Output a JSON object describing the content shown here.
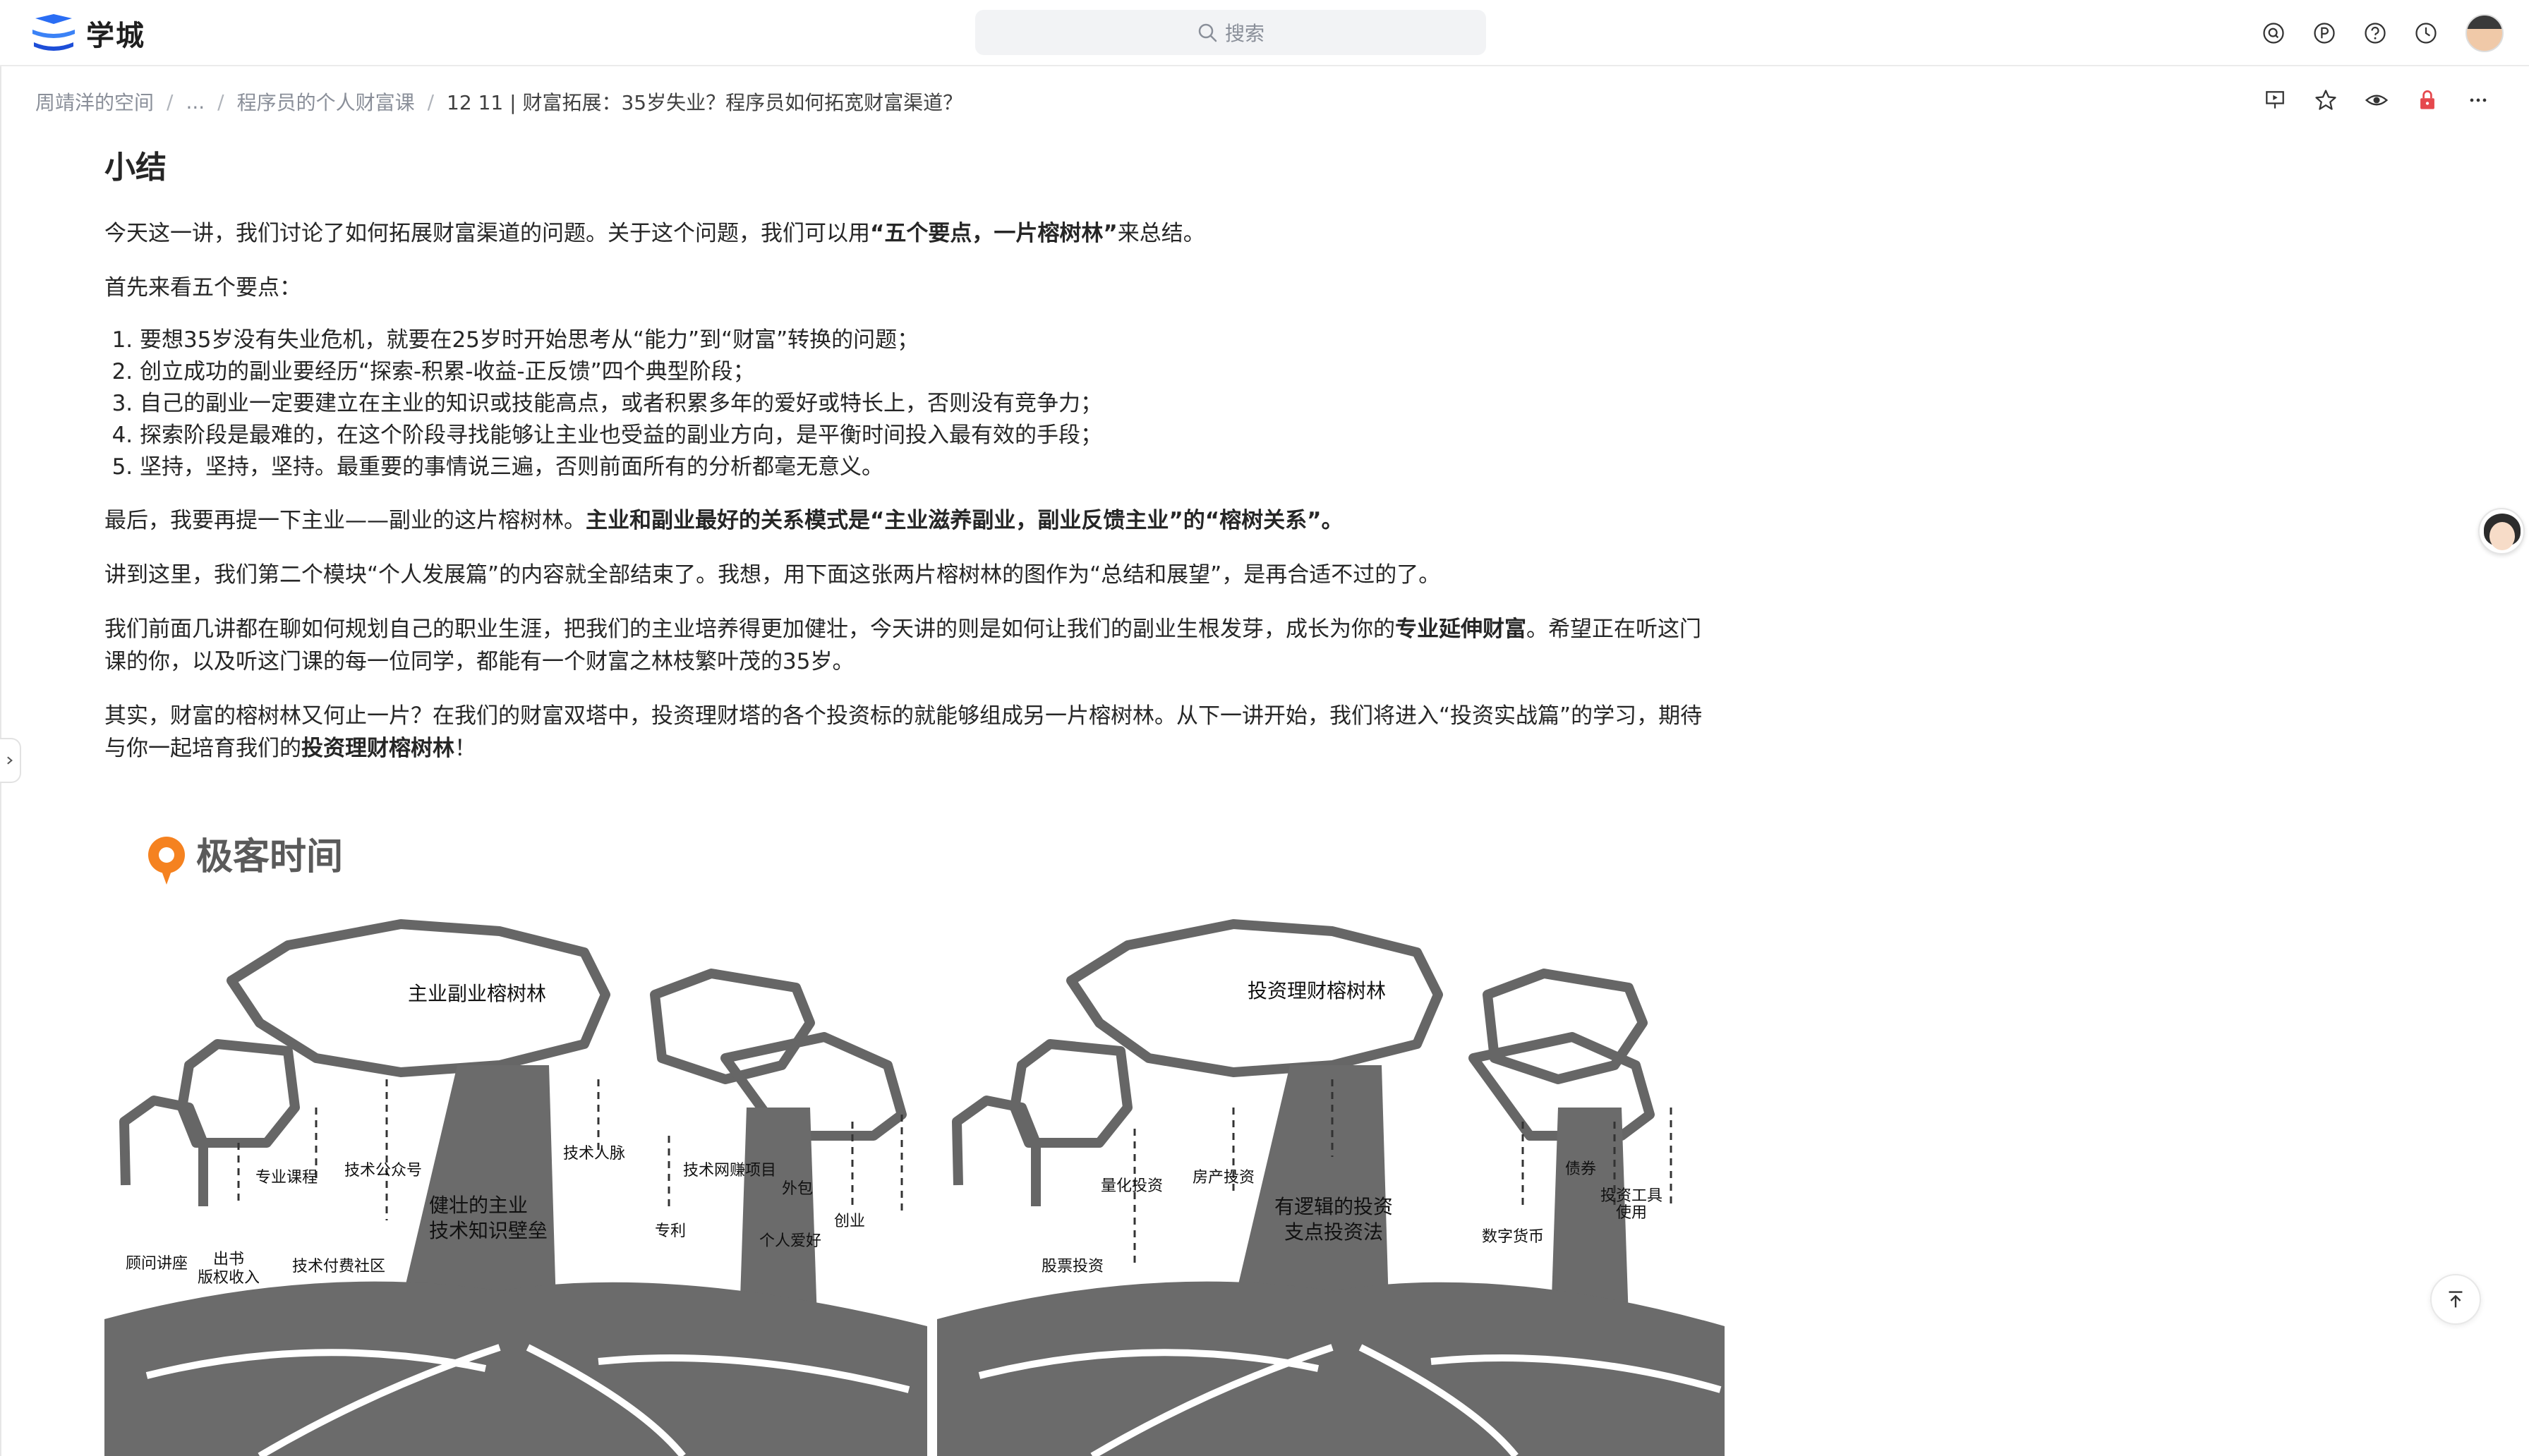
{
  "app": {
    "name": "学城"
  },
  "search": {
    "placeholder": "搜索"
  },
  "top_icons": [
    "q-circle-icon",
    "p-circle-icon",
    "help-icon",
    "history-icon",
    "avatar"
  ],
  "breadcrumb": {
    "items": [
      "周靖洋的空间",
      "...",
      "程序员的个人财富课",
      "12 11 | 财富拓展：35岁失业？程序员如何拓宽财富渠道？"
    ]
  },
  "doc_actions": [
    "present-icon",
    "star-icon",
    "eye-icon",
    "lock-icon",
    "more-icon"
  ],
  "article": {
    "heading": "小结",
    "p1": {
      "a": "今天这一讲，我们讨论了如何拓展财富渠道的问题。关于这个问题，我们可以用",
      "b": "“五个要点，一片榕树林”",
      "c": "来总结。"
    },
    "p2": "首先来看五个要点：",
    "list": [
      "要想35岁没有失业危机，就要在25岁时开始思考从“能力”到“财富”转换的问题；",
      "创立成功的副业要经历“探索-积累-收益-正反馈”四个典型阶段；",
      "自己的副业一定要建立在主业的知识或技能高点，或者积累多年的爱好或特长上，否则没有竞争力；",
      "探索阶段是最难的，在这个阶段寻找能够让主业也受益的副业方向，是平衡时间投入最有效的手段；",
      "坚持，坚持，坚持。最重要的事情说三遍，否则前面所有的分析都毫无意义。"
    ],
    "p3": {
      "a": "最后，我要再提一下主业——副业的这片榕树林。",
      "b": "主业和副业最好的关系模式是“主业滋养副业，副业反馈主业”的“榕树关系”。"
    },
    "p4": "讲到这里，我们第二个模块“个人发展篇”的内容就全部结束了。我想，用下面这张两片榕树林的图作为“总结和展望”，是再合适不过的了。",
    "p5": {
      "a": "我们前面几讲都在聊如何规划自己的职业生涯，把我们的主业培养得更加健壮，今天讲的则是如何让我们的副业生根发芽，成长为你的",
      "b": "专业延伸财富",
      "c": "。希望正在听这门课的你，以及听这门课的每一位同学，都能有一个财富之林枝繁叶茂的35岁。"
    },
    "p6": {
      "a": "其实，财富的榕树林又何止一片？在我们的财富双塔中，投资理财塔的各个投资标的就能够组成另一片榕树林。从下一讲开始，我们将进入“投资实战篇”的学习，期待与你一起培育我们的",
      "b": "投资理财榕树林",
      "c": "！"
    }
  },
  "figure": {
    "brand": "极客时间",
    "left_tree": {
      "title": "主业副业榕树林",
      "trunk": [
        "健壮的主业",
        "技术知识壁垒"
      ],
      "labels": [
        "专业课程",
        "技术公众号",
        "技术人脉",
        "技术网赚项目",
        "外包",
        "创业",
        "专利",
        "个人爱好",
        "顾问讲座",
        "出书",
        "版权收入",
        "技术付费社区"
      ]
    },
    "right_tree": {
      "title": "投资理财榕树林",
      "trunk": [
        "有逻辑的投资",
        "支点投资法"
      ],
      "labels": [
        "量化投资",
        "房产投资",
        "债券",
        "投资工具",
        "使用",
        "数字货币",
        "股票投资"
      ]
    }
  },
  "colors": {
    "accent": "#1f6fff",
    "tree": "#6b6b6b",
    "lock": "#e5484d"
  }
}
